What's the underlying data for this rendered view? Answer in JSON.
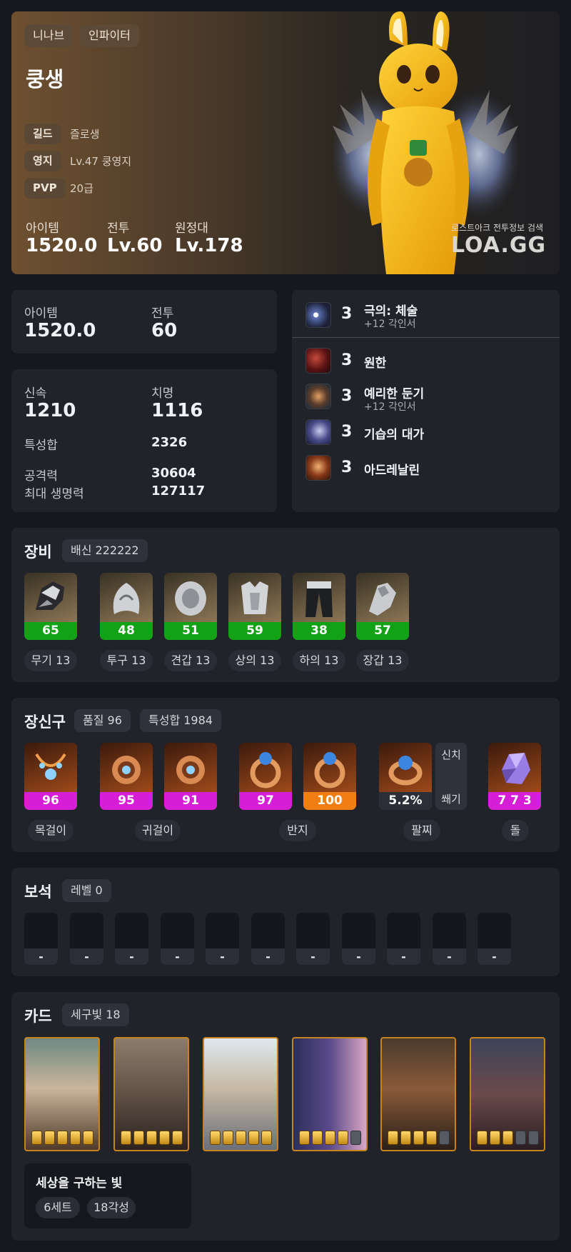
{
  "profile": {
    "server": "니나브",
    "class": "인파이터",
    "name": "쿵생",
    "guild_label": "길드",
    "guild_value": "즐로생",
    "estate_label": "영지",
    "estate_value": "Lv.47 쿵영지",
    "pvp_label": "PVP",
    "pvp_value": "20급",
    "item_label": "아이템",
    "item_value": "1520.0",
    "combat_label": "전투",
    "combat_value": "Lv.60",
    "roster_label": "원정대",
    "roster_value": "Lv.178",
    "watermark_sub": "로스트아크 전투정보 검색",
    "watermark_main": "LOA.GG",
    "accent_color": "#f5b21f"
  },
  "summary": {
    "item_label": "아이템",
    "item_value": "1520.0",
    "combat_label": "전투",
    "combat_value": "60"
  },
  "stats": {
    "swift_label": "신속",
    "swift_value": "1210",
    "crit_label": "치명",
    "crit_value": "1116",
    "total_label": "특성합",
    "total_value": "2326",
    "atk_label": "공격력",
    "atk_value": "30604",
    "hp_label": "최대 생명력",
    "hp_value": "127117"
  },
  "engravings": [
    {
      "level": "3",
      "name": "극의: 체술",
      "sub": "+12 각인서",
      "icon": "fist-engraving-icon"
    },
    {
      "level": "3",
      "name": "원한",
      "sub": "",
      "icon": "grudge-icon"
    },
    {
      "level": "3",
      "name": "예리한 둔기",
      "sub": "+12 각인서",
      "icon": "keen-blunt-icon"
    },
    {
      "level": "3",
      "name": "기습의 대가",
      "sub": "",
      "icon": "master-ambush-icon"
    },
    {
      "level": "3",
      "name": "아드레날린",
      "sub": "",
      "icon": "adrenaline-icon"
    }
  ],
  "equipment": {
    "title": "장비",
    "badge": "배신 222222",
    "items": [
      {
        "quality": "65",
        "label": "무기 13",
        "color": "#12a216",
        "icon": "weapon-gauntlet-icon"
      },
      {
        "quality": "48",
        "label": "투구 13",
        "color": "#12a216",
        "icon": "helmet-icon"
      },
      {
        "quality": "51",
        "label": "견갑 13",
        "color": "#12a216",
        "icon": "shoulder-icon"
      },
      {
        "quality": "59",
        "label": "상의 13",
        "color": "#12a216",
        "icon": "chest-armor-icon"
      },
      {
        "quality": "38",
        "label": "하의 13",
        "color": "#12a216",
        "icon": "pants-icon"
      },
      {
        "quality": "57",
        "label": "장갑 13",
        "color": "#12a216",
        "icon": "gloves-icon"
      }
    ]
  },
  "accessories": {
    "title": "장신구",
    "badge_quality": "품질 96",
    "badge_total": "특성합 1984",
    "items": [
      {
        "quality": "96",
        "color": "#d61ed6",
        "icon": "necklace-icon"
      },
      {
        "quality": "95",
        "color": "#d61ed6",
        "icon": "earring-icon"
      },
      {
        "quality": "91",
        "color": "#d61ed6",
        "icon": "earring-icon"
      },
      {
        "quality": "97",
        "color": "#d61ed6",
        "icon": "ring-icon"
      },
      {
        "quality": "100",
        "color": "#f07e12",
        "icon": "ring-icon"
      }
    ],
    "bracelet": {
      "value": "5.2%",
      "tag1": "신치",
      "tag2": "쐐기",
      "icon": "bracelet-icon"
    },
    "stone": {
      "value": "7 7 3",
      "color": "#d61ed6",
      "icon": "ability-stone-icon"
    },
    "labels": {
      "necklace": "목걸이",
      "earring": "귀걸이",
      "ring": "반지",
      "bracelet": "팔찌",
      "stone": "돌"
    }
  },
  "gems": {
    "title": "보석",
    "badge": "레벨 0",
    "slots": [
      "-",
      "-",
      "-",
      "-",
      "-",
      "-",
      "-",
      "-",
      "-",
      "-",
      "-"
    ]
  },
  "cards": {
    "title": "카드",
    "badge": "세구빛 18",
    "list": [
      {
        "awake": 5
      },
      {
        "awake": 5
      },
      {
        "awake": 5
      },
      {
        "awake": 4
      },
      {
        "awake": 4
      },
      {
        "awake": 3
      }
    ],
    "set_name": "세상을 구하는 빛",
    "set_count": "6세트",
    "set_awake": "18각성"
  }
}
